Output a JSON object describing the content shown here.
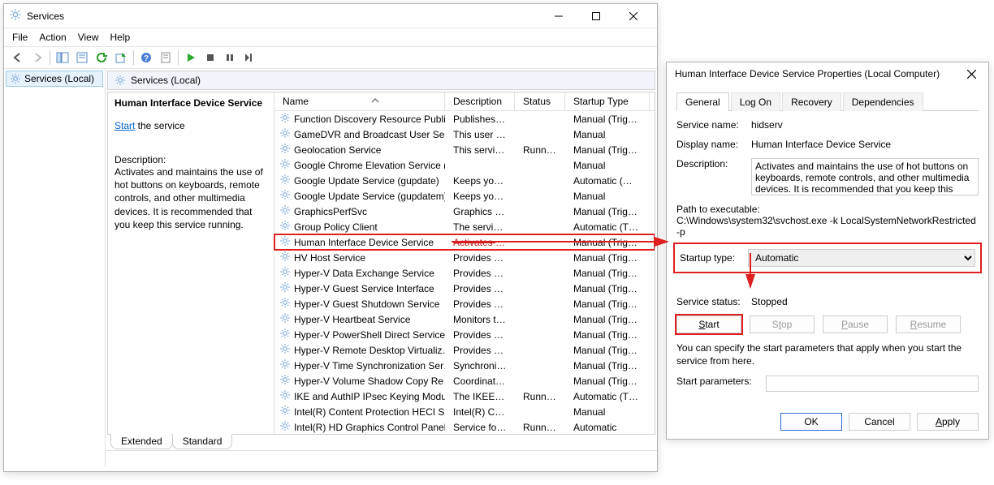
{
  "services_window": {
    "title": "Services",
    "menu": {
      "file": "File",
      "action": "Action",
      "view": "View",
      "help": "Help"
    },
    "toolbar_icons": [
      "nav-back-icon",
      "nav-forward-icon",
      "show-hide-tree-icon",
      "properties-icon",
      "refresh-icon",
      "export-list-icon",
      "help-icon",
      "sheet-icon",
      "service-start-icon",
      "service-stop-icon",
      "service-pause-icon",
      "service-restart-icon"
    ],
    "tree": {
      "root": "Services (Local)"
    },
    "list_header": "Services (Local)",
    "detail": {
      "title": "Human Interface Device Service",
      "start_link": "Start",
      "start_suffix": " the service",
      "desc_label": "Description:",
      "desc_text": "Activates and maintains the use of hot buttons on keyboards, remote controls, and other multimedia devices. It is recommended that you keep this service running."
    },
    "columns": {
      "name": "Name",
      "description": "Description",
      "status": "Status",
      "startup": "Startup Type"
    },
    "rows": [
      {
        "name": "Function Discovery Resource Publi…",
        "desc": "Publishes th…",
        "status": "",
        "startup": "Manual (Trig…"
      },
      {
        "name": "GameDVR and Broadcast User Serv…",
        "desc": "This user ser…",
        "status": "",
        "startup": "Manual"
      },
      {
        "name": "Geolocation Service",
        "desc": "This service …",
        "status": "Running",
        "startup": "Manual (Trig…"
      },
      {
        "name": "Google Chrome Elevation Service (…",
        "desc": "",
        "status": "",
        "startup": "Manual"
      },
      {
        "name": "Google Update Service (gupdate)",
        "desc": "Keeps your …",
        "status": "",
        "startup": "Automatic (…"
      },
      {
        "name": "Google Update Service (gupdatem)",
        "desc": "Keeps your …",
        "status": "",
        "startup": "Manual"
      },
      {
        "name": "GraphicsPerfSvc",
        "desc": "Graphics pe…",
        "status": "",
        "startup": "Manual (Trig…"
      },
      {
        "name": "Group Policy Client",
        "desc": "The service i…",
        "status": "",
        "startup": "Automatic (T…"
      },
      {
        "name": "Human Interface Device Service",
        "desc": "Activates an…",
        "status": "",
        "startup": "Manual (Trig…",
        "highlight": true
      },
      {
        "name": "HV Host Service",
        "desc": "Provides an …",
        "status": "",
        "startup": "Manual (Trig…"
      },
      {
        "name": "Hyper-V Data Exchange Service",
        "desc": "Provides a …",
        "status": "",
        "startup": "Manual (Trig…"
      },
      {
        "name": "Hyper-V Guest Service Interface",
        "desc": "Provides an …",
        "status": "",
        "startup": "Manual (Trig…"
      },
      {
        "name": "Hyper-V Guest Shutdown Service",
        "desc": "Provides a …",
        "status": "",
        "startup": "Manual (Trig…"
      },
      {
        "name": "Hyper-V Heartbeat Service",
        "desc": "Monitors th…",
        "status": "",
        "startup": "Manual (Trig…"
      },
      {
        "name": "Hyper-V PowerShell Direct Service",
        "desc": "Provides a …",
        "status": "",
        "startup": "Manual (Trig…"
      },
      {
        "name": "Hyper-V Remote Desktop Virtualiz…",
        "desc": "Provides a p…",
        "status": "",
        "startup": "Manual (Trig…"
      },
      {
        "name": "Hyper-V Time Synchronization Ser…",
        "desc": "Synchronize…",
        "status": "",
        "startup": "Manual (Trig…"
      },
      {
        "name": "Hyper-V Volume Shadow Copy Re…",
        "desc": "Coordinates …",
        "status": "",
        "startup": "Manual (Trig…"
      },
      {
        "name": "IKE and AuthIP IPsec Keying Modu…",
        "desc": "The IKEEXT …",
        "status": "Running",
        "startup": "Automatic (T…"
      },
      {
        "name": "Intel(R) Content Protection HECI S…",
        "desc": "Intel(R) Con…",
        "status": "",
        "startup": "Manual"
      },
      {
        "name": "Intel(R) HD Graphics Control Panel …",
        "desc": "Service for I…",
        "status": "Running",
        "startup": "Automatic"
      }
    ],
    "bottom_tabs": {
      "extended": "Extended",
      "standard": "Standard"
    }
  },
  "properties_dialog": {
    "title": "Human Interface Device Service Properties (Local Computer)",
    "tabs": {
      "general": "General",
      "logon": "Log On",
      "recovery": "Recovery",
      "dependencies": "Dependencies"
    },
    "labels": {
      "service_name": "Service name:",
      "display_name": "Display name:",
      "description": "Description:",
      "path_to_exe": "Path to executable:",
      "startup_type": "Startup type:",
      "service_status": "Service status:",
      "start_params": "Start parameters:"
    },
    "values": {
      "service_name": "hidserv",
      "display_name": "Human Interface Device Service",
      "description": "Activates and maintains the use of hot buttons on keyboards, remote controls, and other multimedia devices. It is recommended that you keep this",
      "path": "C:\\Windows\\system32\\svchost.exe -k LocalSystemNetworkRestricted -p",
      "startup_type": "Automatic",
      "service_status": "Stopped"
    },
    "note": "You can specify the start parameters that apply when you start the service from here.",
    "buttons": {
      "start": "Start",
      "stop": "Stop",
      "pause": "Pause",
      "resume": "Resume",
      "ok": "OK",
      "cancel": "Cancel",
      "apply": "Apply"
    }
  }
}
